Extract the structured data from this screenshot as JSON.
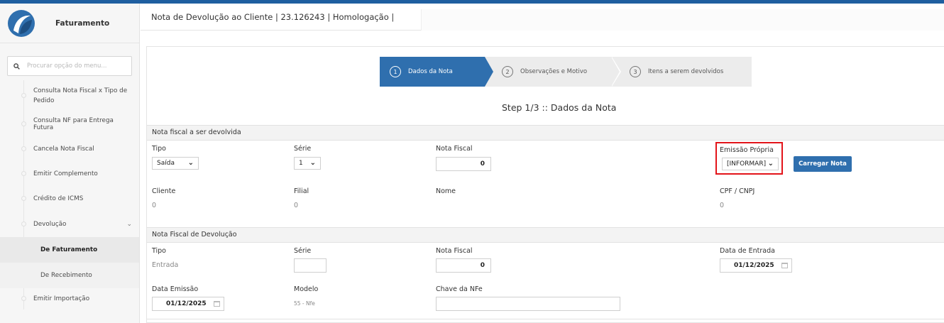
{
  "app": {
    "title": "Faturamento"
  },
  "colors": {
    "accent": "#2f6fae",
    "topbar": "#1f5fa0",
    "highlight": "#e3141a"
  },
  "sidebar": {
    "search_placeholder": "Procurar opção do menu...",
    "items": [
      {
        "label": "Consulta Nota Fiscal x Tipo de Pedido"
      },
      {
        "label": "Consulta NF para Entrega Futura"
      },
      {
        "label": "Cancela Nota Fiscal"
      },
      {
        "label": "Emitir Complemento"
      },
      {
        "label": "Crédito de ICMS"
      },
      {
        "label": "Devolução",
        "chevron": "⌄"
      },
      {
        "label": "De Faturamento"
      },
      {
        "label": "De Recebimento"
      },
      {
        "label": "Emitir Importação"
      }
    ]
  },
  "tab": {
    "title": "Nota de Devolução ao Cliente | 23.126243 | Homologação |"
  },
  "wizard": {
    "steps": [
      {
        "num": "1",
        "label": "Dados da Nota"
      },
      {
        "num": "2",
        "label": "Observações e Motivo"
      },
      {
        "num": "3",
        "label": "Itens a serem devolvidos"
      }
    ],
    "current": "Step 1/3 :: Dados da Nota"
  },
  "nf_devolvida": {
    "header": "Nota fiscal a ser devolvida",
    "tipo": {
      "label": "Tipo",
      "value": "Saída"
    },
    "serie": {
      "label": "Série",
      "value": "1"
    },
    "nota_fiscal": {
      "label": "Nota Fiscal",
      "value": "0"
    },
    "emissao_propria": {
      "label": "Emissão Própria",
      "value": "[INFORMAR]"
    },
    "carregar_button": "Carregar Nota",
    "cliente": {
      "label": "Cliente",
      "value": "0"
    },
    "filial": {
      "label": "Filial",
      "value": "0"
    },
    "nome": {
      "label": "Nome"
    },
    "cpf_cnpj": {
      "label": "CPF / CNPJ",
      "value": "0"
    }
  },
  "nf_devolucao": {
    "header": "Nota Fiscal de Devolução",
    "tipo": {
      "label": "Tipo",
      "value": "Entrada"
    },
    "serie": {
      "label": "Série",
      "value": ""
    },
    "nota_fiscal": {
      "label": "Nota Fiscal",
      "value": "0"
    },
    "data_entrada": {
      "label": "Data de Entrada",
      "value": "01/12/2025"
    },
    "data_emissao": {
      "label": "Data Emissão",
      "value": "01/12/2025"
    },
    "modelo": {
      "label": "Modelo",
      "value": "55 - Nfe"
    },
    "chave": {
      "label": "Chave da NFe",
      "value": ""
    }
  }
}
